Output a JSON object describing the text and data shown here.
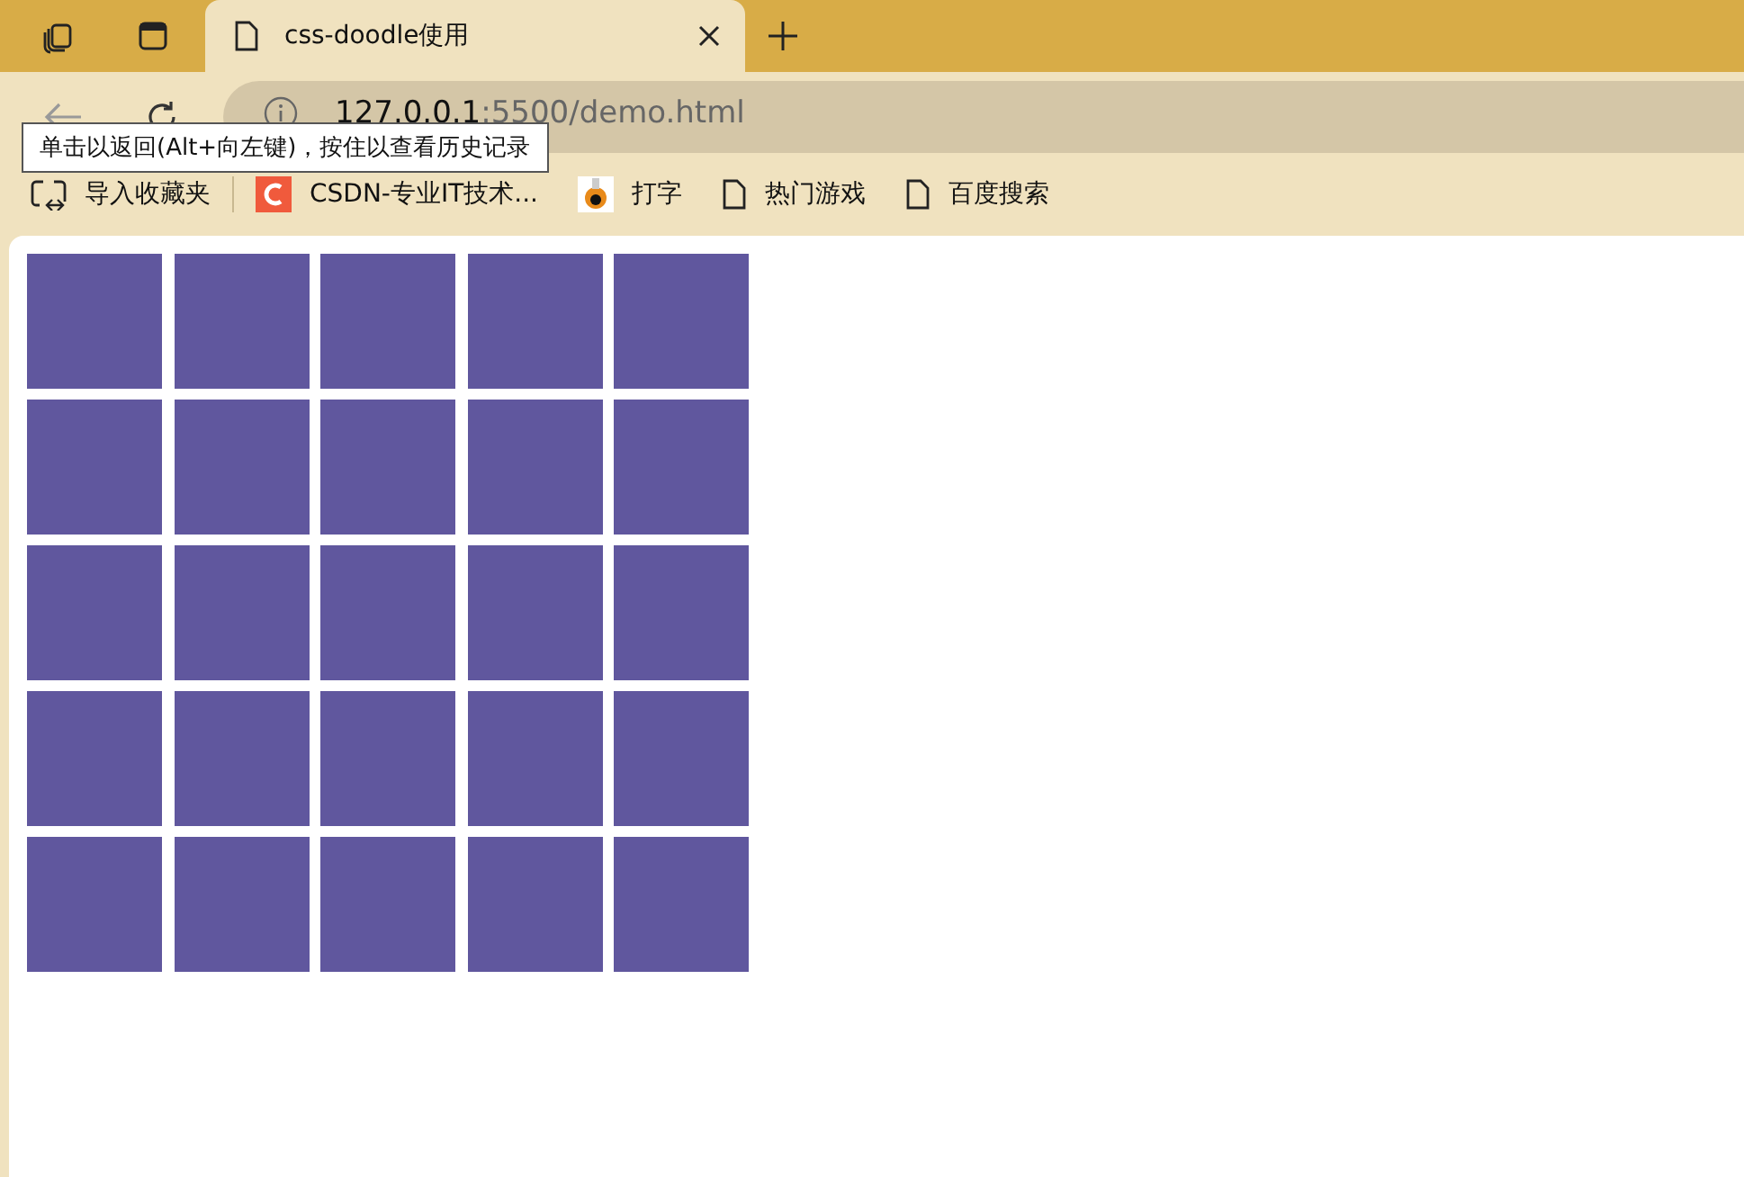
{
  "tabs": [
    {
      "title": "css-doodle使用",
      "selected": true
    }
  ],
  "address": {
    "host": "127.0.0.1",
    "rest": ":5500/demo.html"
  },
  "tooltip": "单击以返回(Alt+向左键)，按住以查看历史记录",
  "bookmarks": [
    {
      "kind": "import",
      "label": "导入收藏夹"
    },
    {
      "kind": "csdn",
      "label": "CSDN-专业IT技术..."
    },
    {
      "kind": "orb",
      "label": "打字"
    },
    {
      "kind": "page",
      "label": "热门游戏"
    },
    {
      "kind": "page",
      "label": "百度搜索"
    }
  ],
  "page": {
    "cells": [
      {
        "kind": "square"
      },
      {
        "kind": "square"
      },
      {
        "kind": "square"
      },
      {
        "kind": "square"
      },
      {
        "kind": "square"
      },
      {
        "kind": "square"
      },
      {
        "kind": "square"
      },
      {
        "kind": "square"
      },
      {
        "kind": "square"
      },
      {
        "kind": "square"
      },
      {
        "kind": "square"
      },
      {
        "kind": "square"
      },
      {
        "kind": "square"
      },
      {
        "kind": "square"
      },
      {
        "kind": "square"
      },
      {
        "kind": "square"
      },
      {
        "kind": "square"
      },
      {
        "kind": "square"
      },
      {
        "kind": "square"
      },
      {
        "kind": "square"
      },
      {
        "kind": "square"
      },
      {
        "kind": "square"
      },
      {
        "kind": "square"
      },
      {
        "kind": "square"
      },
      {
        "kind": "square"
      }
    ]
  }
}
